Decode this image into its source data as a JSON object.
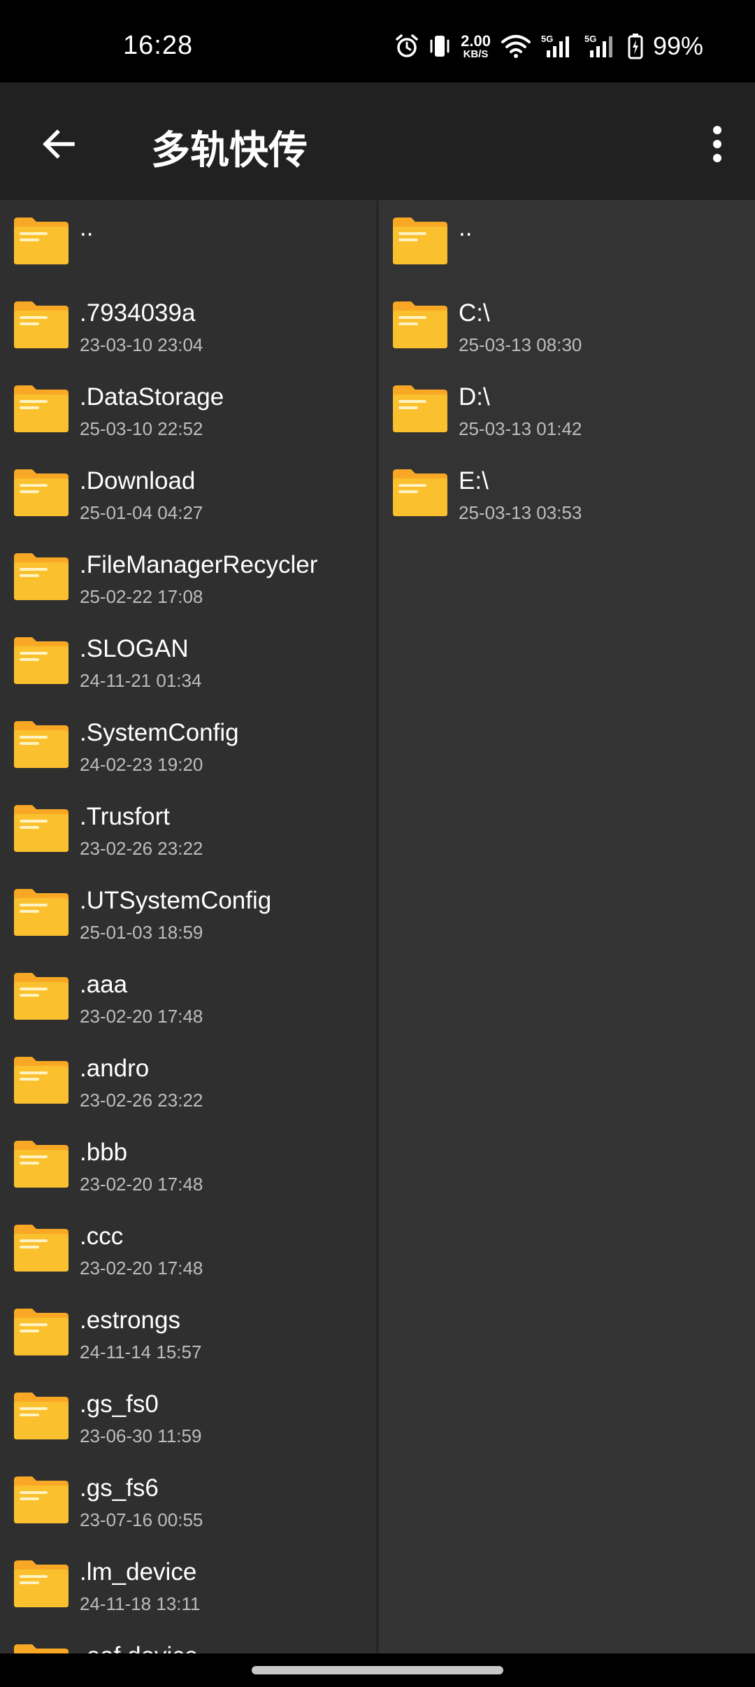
{
  "status_bar": {
    "time": "16:28",
    "speed_value": "2.00",
    "speed_unit": "KB/S",
    "signal1_label": "5G",
    "signal2_label": "5G",
    "battery": "99%",
    "icons": [
      "alarm-icon",
      "vibrate-icon",
      "wifi-icon",
      "signal-icon",
      "signal-icon",
      "battery-charging-icon"
    ]
  },
  "app_bar": {
    "title": "多轨快传",
    "back_icon": "arrow-left-icon",
    "menu_icon": "more-vertical-icon"
  },
  "left_pane": {
    "items": [
      {
        "name": "..",
        "date": ""
      },
      {
        "name": ".7934039a",
        "date": "23-03-10 23:04"
      },
      {
        "name": ".DataStorage",
        "date": "25-03-10 22:52"
      },
      {
        "name": ".Download",
        "date": "25-01-04 04:27"
      },
      {
        "name": ".FileManagerRecycler",
        "date": "25-02-22 17:08"
      },
      {
        "name": ".SLOGAN",
        "date": "24-11-21 01:34"
      },
      {
        "name": ".SystemConfig",
        "date": "24-02-23 19:20"
      },
      {
        "name": ".Trusfort",
        "date": "23-02-26 23:22"
      },
      {
        "name": ".UTSystemConfig",
        "date": "25-01-03 18:59"
      },
      {
        "name": ".aaa",
        "date": "23-02-20 17:48"
      },
      {
        "name": ".andro",
        "date": "23-02-26 23:22"
      },
      {
        "name": ".bbb",
        "date": "23-02-20 17:48"
      },
      {
        "name": ".ccc",
        "date": "23-02-20 17:48"
      },
      {
        "name": ".estrongs",
        "date": "24-11-14 15:57"
      },
      {
        "name": ".gs_fs0",
        "date": "23-06-30 11:59"
      },
      {
        "name": ".gs_fs6",
        "date": "23-07-16 00:55"
      },
      {
        "name": ".lm_device",
        "date": "24-11-18 13:11"
      },
      {
        "name": ".oaf device",
        "date": ""
      }
    ]
  },
  "right_pane": {
    "items": [
      {
        "name": "..",
        "date": ""
      },
      {
        "name": "C:\\",
        "date": "25-03-13 08:30"
      },
      {
        "name": "D:\\",
        "date": "25-03-13 01:42"
      },
      {
        "name": "E:\\",
        "date": "25-03-13 03:53"
      }
    ]
  },
  "colors": {
    "folder": "#fbc02d",
    "folder_tab": "#f9a825",
    "pane_left_bg": "#2f2f2f",
    "pane_right_bg": "#333333",
    "app_bar_bg": "#212121"
  }
}
